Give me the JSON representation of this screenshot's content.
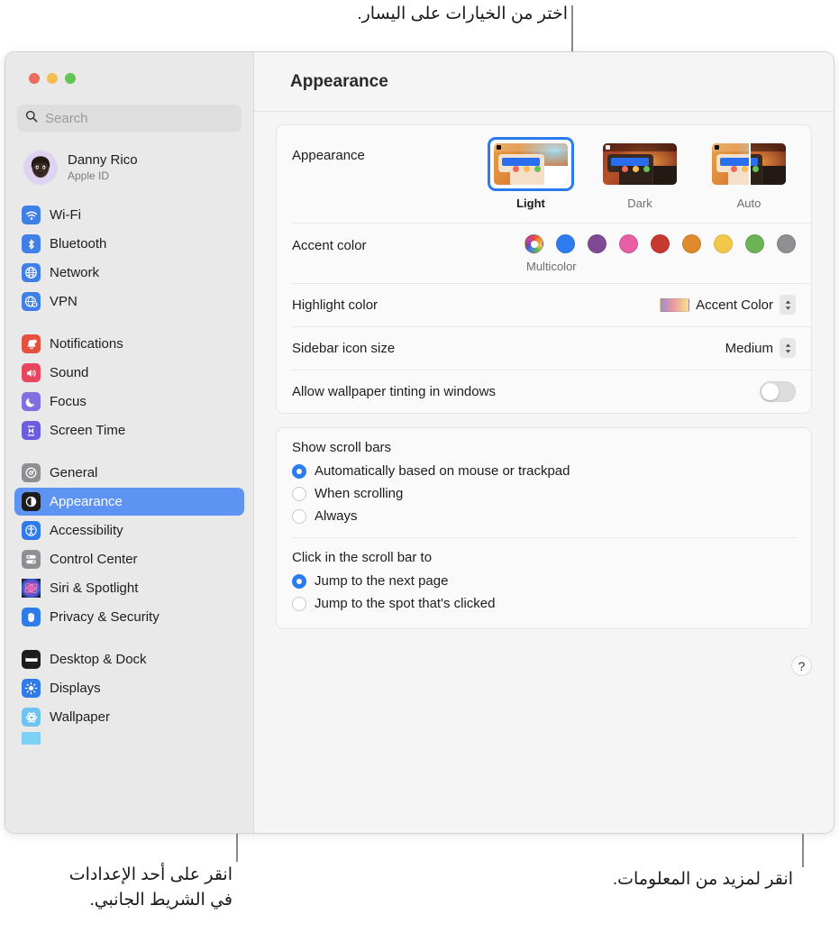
{
  "callouts": {
    "top": "اختر من الخيارات على اليسار.",
    "bottom_left": "انقر على أحد الإعدادات\nفي الشريط الجانبي.",
    "bottom_right": "انقر لمزيد من المعلومات."
  },
  "window": {
    "title": "Appearance",
    "traffic_lights": [
      "close",
      "minimize",
      "zoom"
    ]
  },
  "sidebar": {
    "search": {
      "placeholder": "Search",
      "value": ""
    },
    "account": {
      "name": "Danny Rico",
      "subtitle": "Apple ID"
    },
    "groups": [
      {
        "items": [
          {
            "label": "Wi-Fi",
            "icon": "wifi-icon",
            "color": "#3f7fe8"
          },
          {
            "label": "Bluetooth",
            "icon": "bluetooth-icon",
            "color": "#3f7fe8"
          },
          {
            "label": "Network",
            "icon": "globe-icon",
            "color": "#3f7fe8"
          },
          {
            "label": "VPN",
            "icon": "vpn-globe-icon",
            "color": "#3f7fe8"
          }
        ]
      },
      {
        "items": [
          {
            "label": "Notifications",
            "icon": "bell-icon",
            "color": "#e5503f"
          },
          {
            "label": "Sound",
            "icon": "speaker-icon",
            "color": "#e8455f"
          },
          {
            "label": "Focus",
            "icon": "moon-icon",
            "color": "#7f6fe0"
          },
          {
            "label": "Screen Time",
            "icon": "hourglass-icon",
            "color": "#6b5ce0"
          }
        ]
      },
      {
        "items": [
          {
            "label": "General",
            "icon": "gear-icon",
            "color": "#8e8e93"
          },
          {
            "label": "Appearance",
            "icon": "appearance-icon",
            "color": "#1c1c1e",
            "selected": true
          },
          {
            "label": "Accessibility",
            "icon": "accessibility-icon",
            "color": "#2f7bea"
          },
          {
            "label": "Control Center",
            "icon": "control-center-icon",
            "color": "#8e8e93"
          },
          {
            "label": "Siri & Spotlight",
            "icon": "siri-icon",
            "color": "#2b2b33"
          },
          {
            "label": "Privacy & Security",
            "icon": "hand-icon",
            "color": "#2f7bea"
          }
        ]
      },
      {
        "items": [
          {
            "label": "Desktop & Dock",
            "icon": "desktop-dock-icon",
            "color": "#1c1c1e"
          },
          {
            "label": "Displays",
            "icon": "brightness-icon",
            "color": "#2f7bea"
          },
          {
            "label": "Wallpaper",
            "icon": "wallpaper-icon",
            "color": "#6fc3f0"
          }
        ]
      }
    ]
  },
  "main": {
    "appearance": {
      "label": "Appearance",
      "options": [
        {
          "caption": "Light",
          "selected": true
        },
        {
          "caption": "Dark",
          "selected": false
        },
        {
          "caption": "Auto",
          "selected": false
        }
      ]
    },
    "accent_color": {
      "label": "Accent color",
      "selected_caption": "Multicolor",
      "swatches": [
        {
          "name": "Multicolor",
          "color": "multicolor"
        },
        {
          "name": "Blue",
          "color": "#2f7bf2"
        },
        {
          "name": "Purple",
          "color": "#7e4a95"
        },
        {
          "name": "Pink",
          "color": "#e85fa5"
        },
        {
          "name": "Red",
          "color": "#c8392f"
        },
        {
          "name": "Orange",
          "color": "#e08a2e"
        },
        {
          "name": "Yellow",
          "color": "#f1c84a"
        },
        {
          "name": "Green",
          "color": "#6bb355"
        },
        {
          "name": "Graphite",
          "color": "#8e8e93"
        }
      ]
    },
    "highlight_color": {
      "label": "Highlight color",
      "value": "Accent Color"
    },
    "sidebar_icon_size": {
      "label": "Sidebar icon size",
      "value": "Medium"
    },
    "wallpaper_tinting": {
      "label": "Allow wallpaper tinting in windows",
      "enabled": false
    },
    "show_scroll_bars": {
      "title": "Show scroll bars",
      "options": [
        {
          "label": "Automatically based on mouse or trackpad",
          "selected": true
        },
        {
          "label": "When scrolling",
          "selected": false
        },
        {
          "label": "Always",
          "selected": false
        }
      ]
    },
    "click_scroll_bar": {
      "title": "Click in the scroll bar to",
      "options": [
        {
          "label": "Jump to the next page",
          "selected": true
        },
        {
          "label": "Jump to the spot that's clicked",
          "selected": false
        }
      ]
    },
    "help_button": {
      "label": "?"
    }
  }
}
